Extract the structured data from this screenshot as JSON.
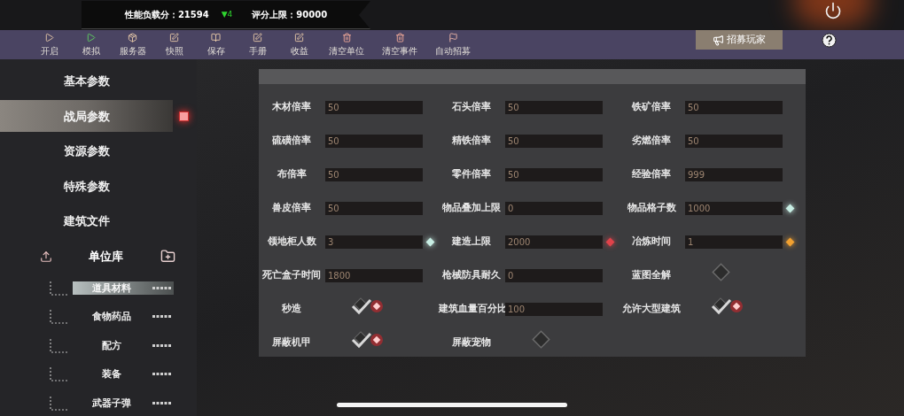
{
  "header": {
    "load_label": "性能负载分：21594",
    "trend": "▼4",
    "limit_label": "评分上限：90000"
  },
  "toolbar": [
    {
      "label": "开启"
    },
    {
      "label": "模拟"
    },
    {
      "label": "服务器"
    },
    {
      "label": "快照"
    },
    {
      "label": "保存"
    },
    {
      "label": "手册"
    },
    {
      "label": "收益"
    },
    {
      "label": "清空单位"
    },
    {
      "label": "清空事件"
    },
    {
      "label": "自动招募"
    }
  ],
  "recruit_button": "招募玩家",
  "sidebar": {
    "items": [
      {
        "label": "基本参数",
        "selected": false
      },
      {
        "label": "战局参数",
        "selected": true
      },
      {
        "label": "资源参数",
        "selected": false
      },
      {
        "label": "特殊参数",
        "selected": false
      },
      {
        "label": "建筑文件",
        "selected": false
      }
    ],
    "library": {
      "label": "单位库",
      "children": [
        {
          "label": "道具材料",
          "selected": true
        },
        {
          "label": "食物药品",
          "selected": false
        },
        {
          "label": "配方",
          "selected": false
        },
        {
          "label": "装备",
          "selected": false
        },
        {
          "label": "武器子弹",
          "selected": false
        }
      ]
    }
  },
  "settings": [
    {
      "kind": "field",
      "label": "木材倍率",
      "value": "50"
    },
    {
      "kind": "field",
      "label": "石头倍率",
      "value": "50"
    },
    {
      "kind": "field",
      "label": "铁矿倍率",
      "value": "50"
    },
    {
      "kind": "field",
      "label": "硫磺倍率",
      "value": "50"
    },
    {
      "kind": "field",
      "label": "精铁倍率",
      "value": "50"
    },
    {
      "kind": "field",
      "label": "劣燃倍率",
      "value": "50"
    },
    {
      "kind": "field",
      "label": "布倍率",
      "value": "50"
    },
    {
      "kind": "field",
      "label": "零件倍率",
      "value": "50"
    },
    {
      "kind": "field",
      "label": "经验倍率",
      "value": "999"
    },
    {
      "kind": "field",
      "label": "兽皮倍率",
      "value": "50"
    },
    {
      "kind": "field",
      "label": "物品叠加上限",
      "value": "0"
    },
    {
      "kind": "field",
      "label": "物品格子数",
      "value": "1000",
      "color": "#c8eee4"
    },
    {
      "kind": "field",
      "label": "领地柜人数",
      "value": "3",
      "color": "#c8eee4"
    },
    {
      "kind": "field",
      "label": "建造上限",
      "value": "2000",
      "color": "#e0424a"
    },
    {
      "kind": "field",
      "label": "冶炼时间",
      "value": "1",
      "color": "#f0a030"
    },
    {
      "kind": "field",
      "label": "死亡盒子时间",
      "value": "1800"
    },
    {
      "kind": "field",
      "label": "枪械防具耐久",
      "value": "0"
    },
    {
      "kind": "toggle",
      "label": "蓝图全解",
      "checked": false
    },
    {
      "kind": "toggle",
      "label": "秒造",
      "checked": true
    },
    {
      "kind": "field",
      "label": "建筑血量百分比",
      "value": "100"
    },
    {
      "kind": "toggle",
      "label": "允许大型建筑",
      "checked": true
    },
    {
      "kind": "toggle",
      "label": "屏蔽机甲",
      "checked": true
    },
    {
      "kind": "toggle",
      "label": "屏蔽宠物",
      "checked": false
    }
  ]
}
